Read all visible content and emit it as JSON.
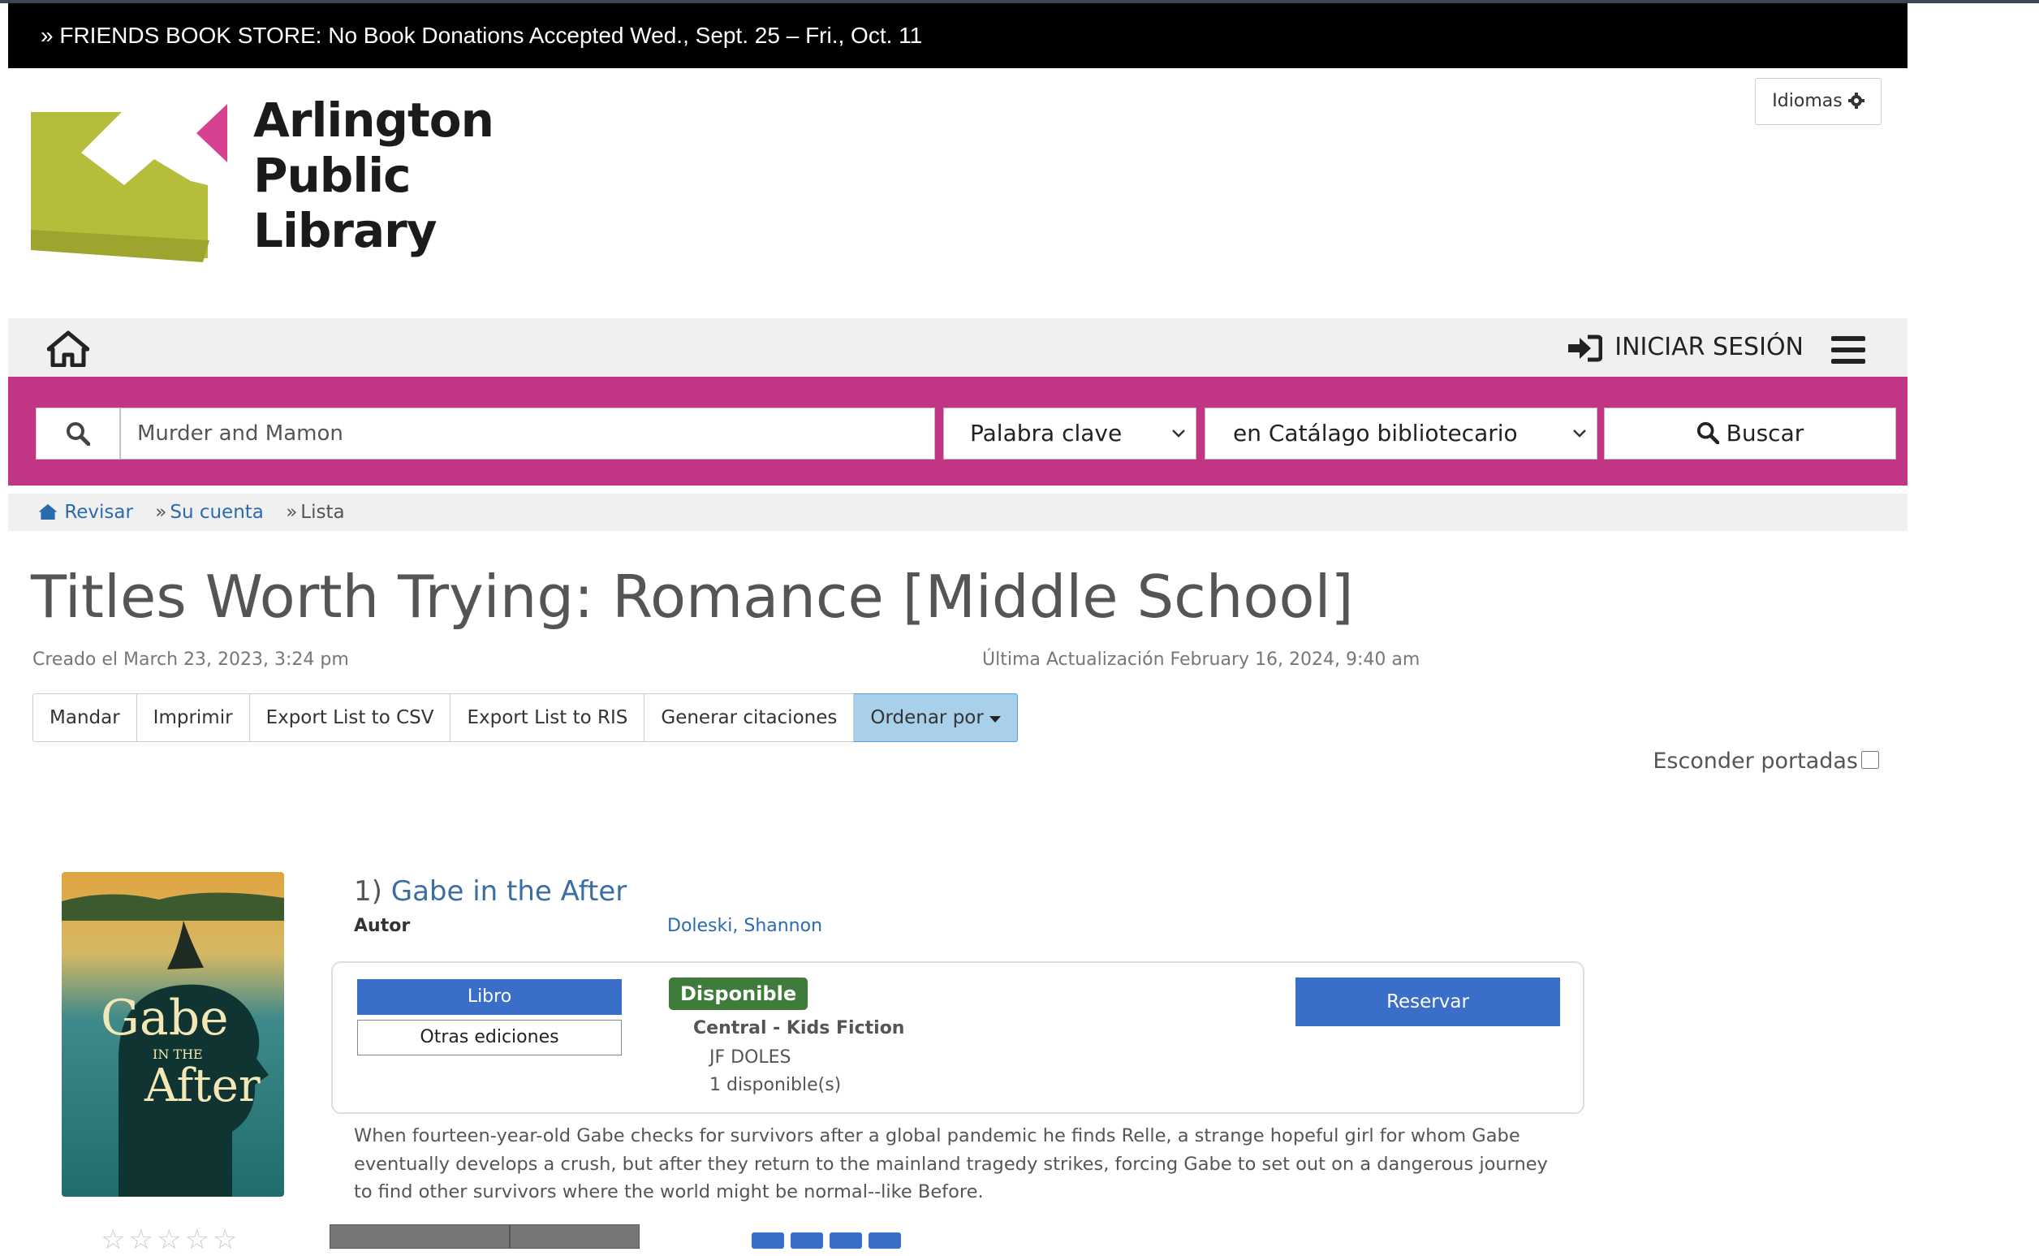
{
  "banner": {
    "text": "» FRIENDS BOOK STORE: No Book Donations Accepted Wed., Sept. 25 – Fri., Oct. 11"
  },
  "logo": {
    "line1": "Arlington",
    "line2": "Public",
    "line3": "Library"
  },
  "language_button": {
    "label": "Idiomas"
  },
  "nav": {
    "login_label": "INICIAR SESIÓN"
  },
  "search": {
    "query": "Murder and Mamon",
    "search_type": "Palabra clave",
    "scope": "en Catálago bibliotecario",
    "button_label": "Buscar"
  },
  "breadcrumb": {
    "home": "Revisar",
    "account": "Su cuenta",
    "current": "Lista",
    "separator": "»"
  },
  "list": {
    "title": "Titles Worth Trying: Romance [Middle School]",
    "created": "Creado el March 23, 2023, 3:24 pm",
    "updated": "Última Actualización February 16, 2024, 9:40 am"
  },
  "actions": {
    "email": "Mandar",
    "print": "Imprimir",
    "csv": "Export List to CSV",
    "ris": "Export List to RIS",
    "citations": "Generar citaciones",
    "sort": "Ordenar por"
  },
  "hide_covers": {
    "label": "Esconder portadas"
  },
  "results": [
    {
      "number": "1)",
      "title": "Gabe in the After",
      "author_label": "Autor",
      "author": "Doleski, Shannon",
      "format": "Libro",
      "other_editions": "Otras ediciones",
      "availability": "Disponible",
      "location": "Central - Kids Fiction",
      "call_number": "JF DOLES",
      "copies": "1 disponible(s)",
      "hold_label": "Reservar",
      "description": "When fourteen-year-old Gabe checks for survivors after a global pandemic he finds Relle, a strange hopeful girl for whom Gabe eventually develops a crush, but after they return to the mainland tragedy strikes, forcing Gabe to set out on a dangerous journey to find other survivors where the world might be normal--like Before.",
      "cover_title_1": "Gabe",
      "cover_title_2": "IN THE",
      "cover_title_3": "After"
    }
  ],
  "colors": {
    "banner_bg": "#000000",
    "search_band": "#c13584",
    "link": "#2a6bb0",
    "primary_button": "#3a6ec8",
    "available": "#3f7c3b",
    "logo_green": "#b5bd3a",
    "logo_pink": "#d8418f"
  },
  "icons": [
    "home-icon",
    "sign-in-icon",
    "hamburger-icon",
    "search-icon",
    "chevron-down-icon",
    "gear-icon",
    "caret-down-icon",
    "home-small-icon",
    "star-icon"
  ]
}
